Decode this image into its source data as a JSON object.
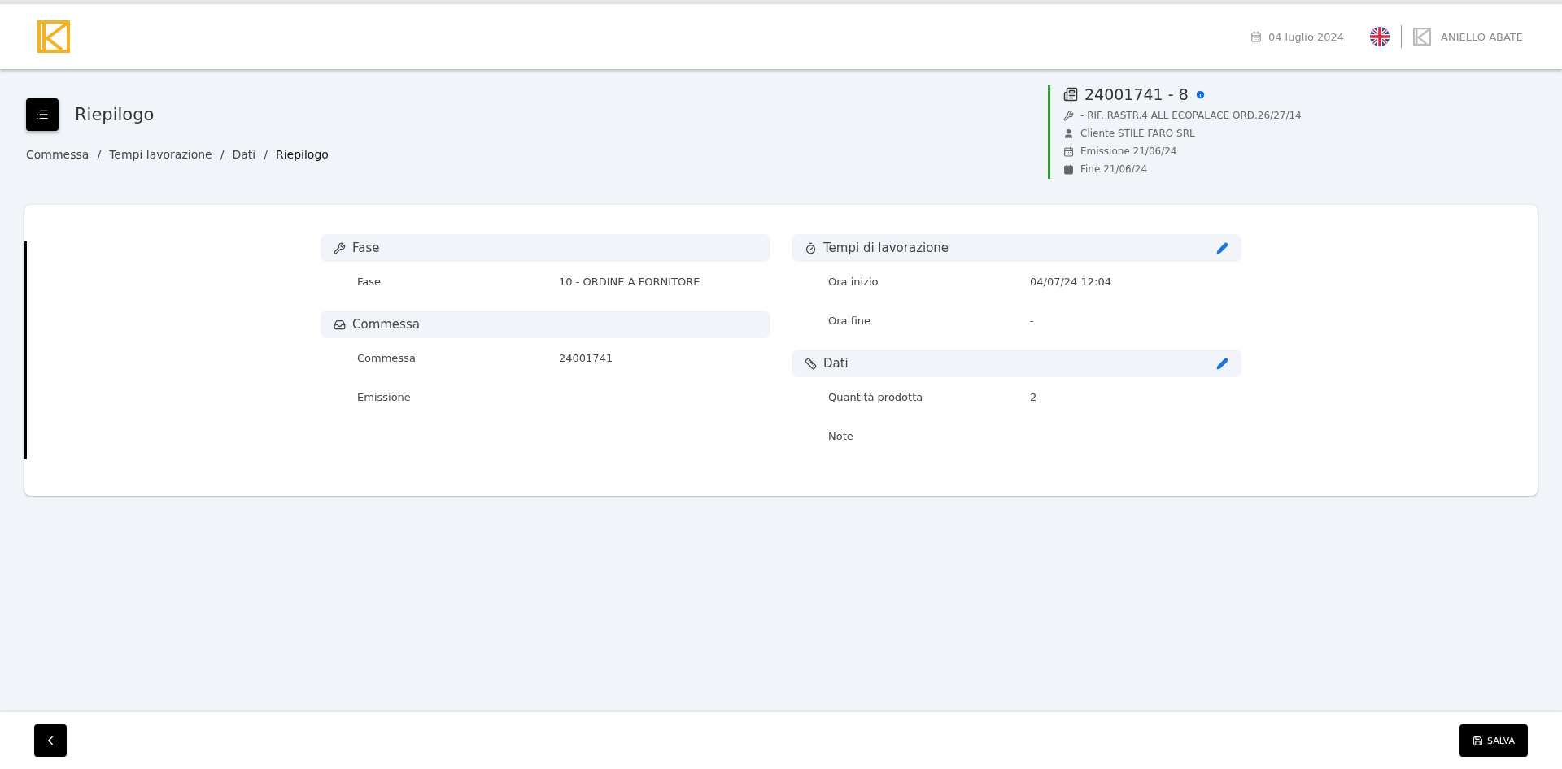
{
  "header": {
    "date": "04 luglio 2024",
    "user": "ANIELLO ABATE"
  },
  "page": {
    "title": "Riepilogo"
  },
  "breadcrumbs": [
    {
      "label": "Commessa",
      "selected": false
    },
    {
      "label": "Tempi lavorazione",
      "selected": false
    },
    {
      "label": "Dati",
      "selected": false
    },
    {
      "label": "Riepilogo",
      "selected": true
    }
  ],
  "separator": "/",
  "order": {
    "code": "24001741 - 8",
    "lines": [
      {
        "kind": "wrench",
        "text": "- RIF. RASTR.4 ALL ECOPALACE ORD.26/27/14"
      },
      {
        "kind": "person",
        "text": "Cliente STILE FARO SRL"
      },
      {
        "kind": "calendar",
        "text": "Emissione 21/06/24"
      },
      {
        "kind": "calendar-blank",
        "text": "Fine 21/06/24"
      }
    ]
  },
  "columns": [
    [
      {
        "kind": "phase",
        "title": "Fase",
        "editable": false,
        "rows": [
          {
            "label": "Fase",
            "value": "10 - ORDINE A FORNITORE"
          }
        ]
      },
      {
        "kind": "inbox",
        "title": "Commessa",
        "editable": false,
        "rows": [
          {
            "label": "Commessa",
            "value": "24001741"
          },
          {
            "label": "Emissione",
            "value": ""
          }
        ]
      }
    ],
    [
      {
        "kind": "timer",
        "title": "Tempi di lavorazione",
        "editable": true,
        "rows": [
          {
            "label": "Ora inizio",
            "value": "04/07/24 12:04"
          },
          {
            "label": "Ora fine",
            "value": "-"
          }
        ]
      },
      {
        "kind": "ruler",
        "title": "Dati",
        "editable": true,
        "rows": [
          {
            "label": "Quantità prodotta",
            "value": "2"
          },
          {
            "label": "Note",
            "value": ""
          }
        ]
      }
    ]
  ],
  "footer": {
    "save": "SALVA"
  }
}
